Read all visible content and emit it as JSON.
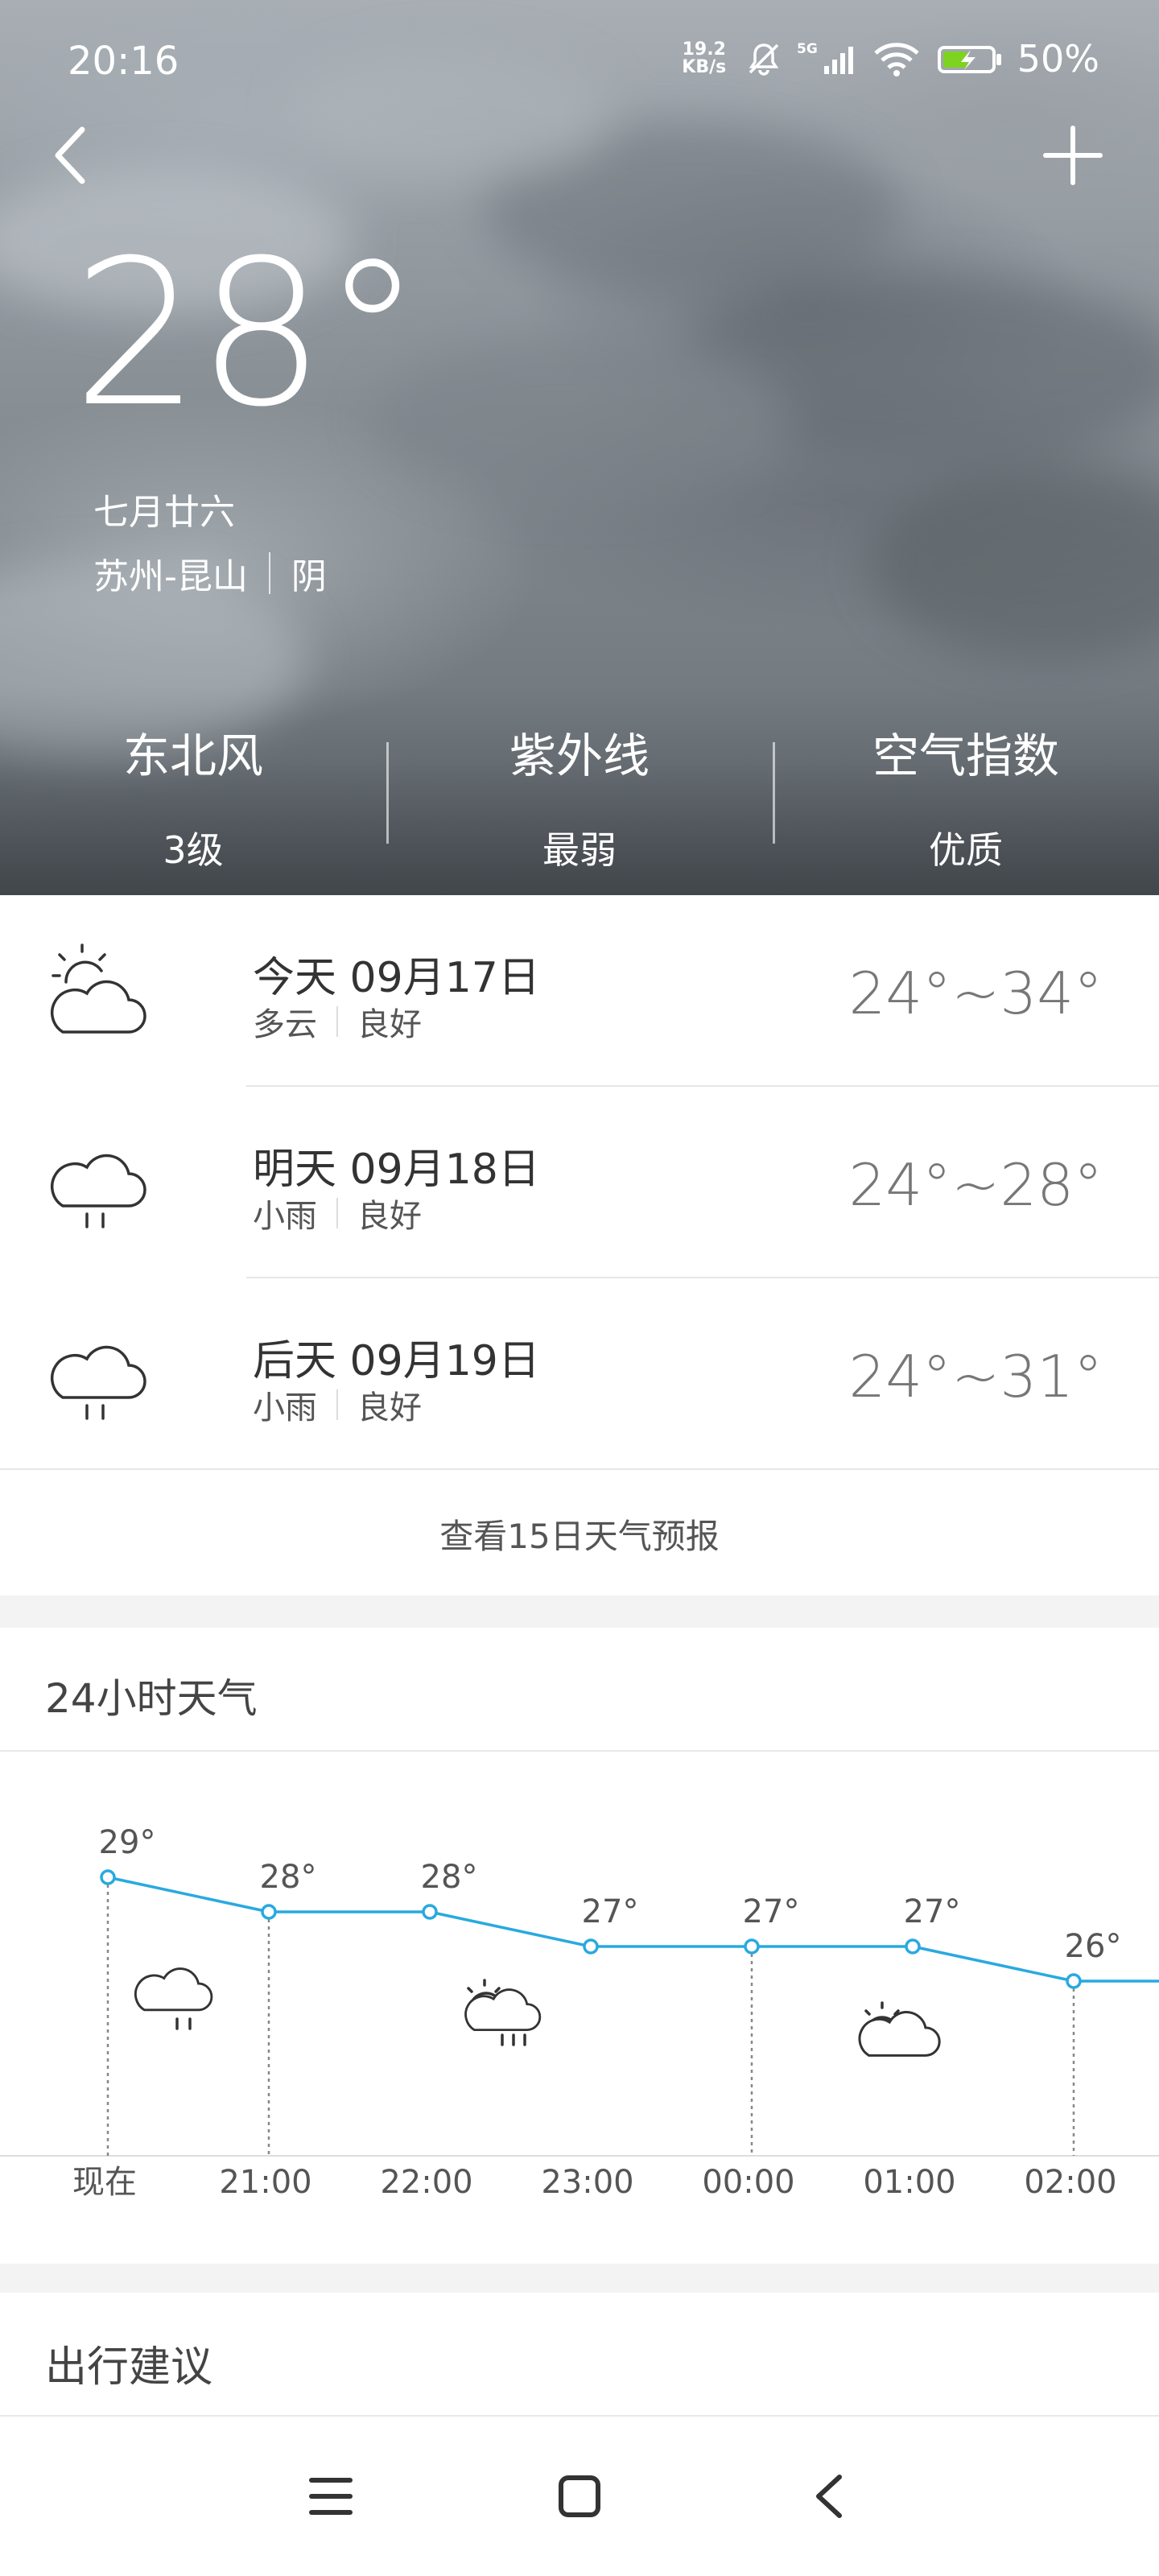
{
  "status_bar": {
    "time": "20:16",
    "net_speed_value": "19.2",
    "net_speed_unit": "KB/s",
    "network": "5G",
    "battery_percent": "50%",
    "icons": [
      "mute-bell-icon",
      "signal-5g-icon",
      "wifi-icon",
      "battery-charging-icon"
    ]
  },
  "top_bar": {
    "back_icon": "chevron-left-icon",
    "add_icon": "plus-icon"
  },
  "current": {
    "temperature": "28°",
    "lunar_date": "七月廿六",
    "location": "苏州-昆山",
    "condition": "阴"
  },
  "stats": [
    {
      "title": "东北风",
      "value": "3级"
    },
    {
      "title": "紫外线",
      "value": "最弱"
    },
    {
      "title": "空气指数",
      "value": "优质"
    }
  ],
  "forecast": [
    {
      "day": "今天 09月17日",
      "condition": "多云",
      "air": "良好",
      "range": "24°~34°",
      "icon": "partly-cloudy-icon"
    },
    {
      "day": "明天 09月18日",
      "condition": "小雨",
      "air": "良好",
      "range": "24°~28°",
      "icon": "light-rain-icon"
    },
    {
      "day": "后天 09月19日",
      "condition": "小雨",
      "air": "良好",
      "range": "24°~31°",
      "icon": "light-rain-icon"
    }
  ],
  "more_link": "查看15日天气预报",
  "hourly": {
    "title": "24小时天气",
    "points": [
      {
        "time": "现在",
        "temp": 29,
        "label": "29°"
      },
      {
        "time": "21:00",
        "temp": 28,
        "label": "28°"
      },
      {
        "time": "22:00",
        "temp": 28,
        "label": "28°"
      },
      {
        "time": "23:00",
        "temp": 27,
        "label": "27°"
      },
      {
        "time": "00:00",
        "temp": 27,
        "label": "27°"
      },
      {
        "time": "01:00",
        "temp": 27,
        "label": "27°"
      },
      {
        "time": "02:00",
        "temp": 26,
        "label": "26°"
      }
    ],
    "line_color": "#29a9e0",
    "segment_icons": [
      "light-rain-icon",
      "sun-rain-icon",
      "partly-cloudy-icon"
    ]
  },
  "advice": {
    "title": "出行建议"
  },
  "nav": {
    "icons": [
      "menu-icon",
      "home-icon",
      "back-icon"
    ]
  }
}
